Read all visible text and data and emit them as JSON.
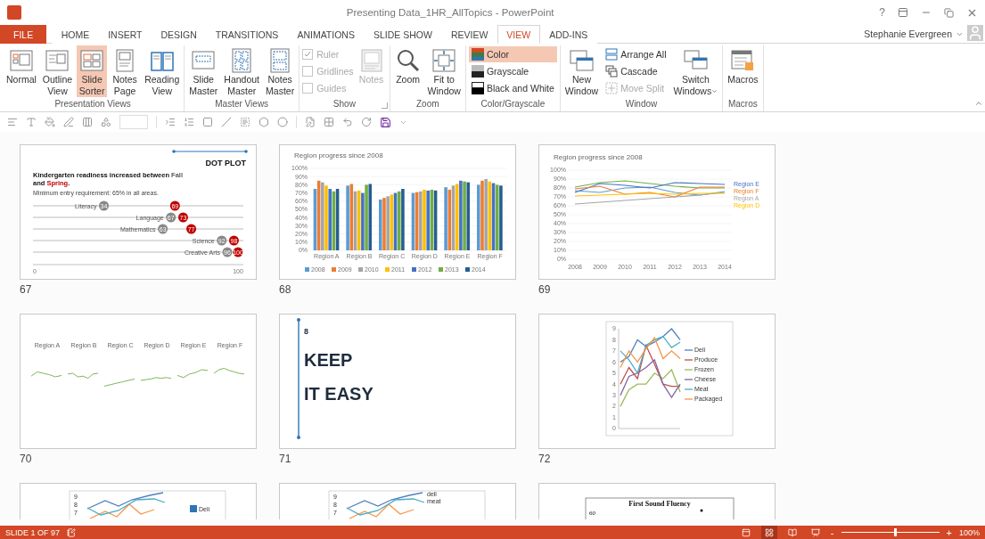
{
  "window": {
    "title": "Presenting Data_1HR_AllTopics - PowerPoint",
    "help": "?"
  },
  "tabs": [
    {
      "label": "FILE",
      "kind": "file",
      "selected": false
    },
    {
      "label": "HOME",
      "kind": "tab",
      "selected": false
    },
    {
      "label": "INSERT",
      "kind": "tab",
      "selected": false
    },
    {
      "label": "DESIGN",
      "kind": "tab",
      "selected": false
    },
    {
      "label": "TRANSITIONS",
      "kind": "tab",
      "selected": false
    },
    {
      "label": "ANIMATIONS",
      "kind": "tab",
      "selected": false
    },
    {
      "label": "SLIDE SHOW",
      "kind": "tab",
      "selected": false
    },
    {
      "label": "REVIEW",
      "kind": "tab",
      "selected": false
    },
    {
      "label": "VIEW",
      "kind": "tab",
      "selected": true
    },
    {
      "label": "ADD-INS",
      "kind": "tab",
      "selected": false
    }
  ],
  "user": {
    "name": "Stephanie Evergreen"
  },
  "ribbon_groups": [
    {
      "label": "Presentation Views",
      "items": [
        {
          "kind": "large",
          "lines": [
            "Normal"
          ],
          "selected": false
        },
        {
          "kind": "large",
          "lines": [
            "Outline",
            "View"
          ],
          "selected": false
        },
        {
          "kind": "large",
          "lines": [
            "Slide",
            "Sorter"
          ],
          "selected": true
        },
        {
          "kind": "large",
          "lines": [
            "Notes",
            "Page"
          ],
          "selected": false
        },
        {
          "kind": "large",
          "lines": [
            "Reading",
            "View"
          ],
          "selected": false
        }
      ]
    },
    {
      "label": "Master Views",
      "items": [
        {
          "kind": "large",
          "lines": [
            "Slide",
            "Master"
          ],
          "selected": false
        },
        {
          "kind": "large",
          "lines": [
            "Handout",
            "Master"
          ],
          "selected": false
        },
        {
          "kind": "large",
          "lines": [
            "Notes",
            "Master"
          ],
          "selected": false
        }
      ]
    },
    {
      "label": "Show",
      "launcher": true,
      "items": [
        {
          "kind": "checks",
          "checks": [
            {
              "label": "Ruler",
              "checked": true,
              "disabled": true
            },
            {
              "label": "Gridlines",
              "checked": false,
              "disabled": true
            },
            {
              "label": "Guides",
              "checked": false,
              "disabled": true
            }
          ]
        },
        {
          "kind": "large",
          "lines": [
            "Notes"
          ],
          "selected": false,
          "disabled": true
        }
      ]
    },
    {
      "label": "Zoom",
      "items": [
        {
          "kind": "large",
          "lines": [
            "Zoom"
          ],
          "selected": false
        },
        {
          "kind": "large",
          "lines": [
            "Fit to",
            "Window"
          ],
          "selected": false
        }
      ]
    },
    {
      "label": "Color/Grayscale",
      "items": [
        {
          "kind": "smalls",
          "smalls": [
            {
              "label": "Color",
              "selected": true,
              "disabled": false
            },
            {
              "label": "Grayscale",
              "selected": false,
              "disabled": false
            },
            {
              "label": "Black and White",
              "selected": false,
              "disabled": false
            }
          ]
        }
      ]
    },
    {
      "label": "Window",
      "items": [
        {
          "kind": "large",
          "lines": [
            "New",
            "Window"
          ],
          "selected": false
        },
        {
          "kind": "smalls",
          "smalls": [
            {
              "label": "Arrange All",
              "selected": false,
              "disabled": false
            },
            {
              "label": "Cascade",
              "selected": false,
              "disabled": false
            },
            {
              "label": "Move Split",
              "selected": false,
              "disabled": true
            }
          ]
        },
        {
          "kind": "large",
          "lines": [
            "Switch",
            "Windows"
          ],
          "selected": false,
          "dropdown": true
        }
      ]
    },
    {
      "label": "Macros",
      "items": [
        {
          "kind": "large",
          "lines": [
            "Macros"
          ],
          "selected": false
        }
      ]
    }
  ],
  "slides": [
    {
      "number": "67",
      "kind": "dot_plot",
      "tag": "DOT PLOT",
      "headline": [
        [
          {
            "text": "Kindergarten readiness increased between "
          },
          {
            "text": "Fall",
            "color": "#595959"
          }
        ],
        [
          {
            "text": "and "
          },
          {
            "text": "Spring",
            "color": "#c00000"
          },
          {
            "text": "."
          }
        ]
      ],
      "subtitle": "Minimum entry requirement: 65% in all areas.",
      "rows": [
        {
          "label": "Literacy",
          "fall": "34",
          "spring": "69"
        },
        {
          "label": "Language",
          "fall": "67",
          "spring": "73"
        },
        {
          "label": "Mathematics",
          "fall": "63",
          "spring": "77"
        },
        {
          "label": "Science",
          "fall": "92",
          "spring": "98"
        },
        {
          "label": "Creative Arts",
          "fall": "96",
          "spring": "100"
        }
      ],
      "axis": [
        "0",
        "100"
      ]
    },
    {
      "number": "68",
      "kind": "chart",
      "chart_data": {
        "type": "bar",
        "title": "Region progress since 2008",
        "grid": true,
        "legend": true,
        "categories": [
          "Region A",
          "Region B",
          "Region C",
          "Region D",
          "Region E",
          "Region F"
        ],
        "series": [
          {
            "name": "2008",
            "color": "#5b9bd5",
            "values": [
              75,
              79,
              62,
              70,
              77,
              80
            ]
          },
          {
            "name": "2009",
            "color": "#ed7d31",
            "values": [
              85,
              81,
              64,
              71,
              74,
              85
            ]
          },
          {
            "name": "2010",
            "color": "#a5a5a5",
            "values": [
              83,
              72,
              66,
              72,
              79,
              87
            ]
          },
          {
            "name": "2011",
            "color": "#ffc000",
            "values": [
              79,
              73,
              68,
              74,
              81,
              84
            ]
          },
          {
            "name": "2012",
            "color": "#4472c4",
            "values": [
              75,
              70,
              70,
              73,
              85,
              82
            ]
          },
          {
            "name": "2013",
            "color": "#70ad47",
            "values": [
              72,
              80,
              72,
              74,
              84,
              80
            ]
          },
          {
            "name": "2014",
            "color": "#255e91",
            "values": [
              75,
              81,
              75,
              73,
              83,
              79
            ]
          }
        ],
        "ylim": [
          0,
          100
        ],
        "yticks": [
          {
            "value": 0,
            "label": "0%"
          },
          {
            "value": 10,
            "label": "10%"
          },
          {
            "value": 20,
            "label": "20%"
          },
          {
            "value": 30,
            "label": "30%"
          },
          {
            "value": 40,
            "label": "40%"
          },
          {
            "value": 50,
            "label": "50%"
          },
          {
            "value": 60,
            "label": "60%"
          },
          {
            "value": 70,
            "label": "70%"
          },
          {
            "value": 80,
            "label": "80%"
          },
          {
            "value": 90,
            "label": "90%"
          },
          {
            "value": 100,
            "label": "100%"
          }
        ]
      }
    },
    {
      "number": "69",
      "kind": "chart",
      "chart_data": {
        "type": "line",
        "title": "Region progress since 2008",
        "grid": true,
        "legend": true,
        "categories": [
          "2008",
          "2009",
          "2010",
          "2011",
          "2012",
          "2013",
          "2014"
        ],
        "series": [
          {
            "color": "#70ad47",
            "values": [
              81,
              86,
              88,
              85,
              82,
              80,
              80
            ]
          },
          {
            "color": "#5b9bd5",
            "values": [
              77,
              75,
              80,
              81,
              75,
              72,
              76
            ]
          },
          {
            "name": "Region E",
            "color": "#4472c4",
            "values": [
              75,
              85,
              83,
              80,
              86,
              85,
              84
            ]
          },
          {
            "name": "Region F",
            "color": "#ed7d31",
            "values": [
              79,
              82,
              73,
              75,
              70,
              81,
              81
            ]
          },
          {
            "name": "Region A",
            "color": "#a5a5a5",
            "values": [
              62,
              64,
              66,
              68,
              70,
              72,
              75
            ]
          },
          {
            "name": "Region D",
            "color": "#ffc000",
            "values": [
              71,
              72,
              73,
              74,
              73,
              74,
              74
            ]
          }
        ],
        "ylim": [
          0,
          100
        ],
        "yticks": [
          {
            "value": 0,
            "label": "0%"
          },
          {
            "value": 10,
            "label": "10%"
          },
          {
            "value": 20,
            "label": "20%"
          },
          {
            "value": 30,
            "label": "30%"
          },
          {
            "value": 40,
            "label": "40%"
          },
          {
            "value": 50,
            "label": "50%"
          },
          {
            "value": 60,
            "label": "60%"
          },
          {
            "value": 70,
            "label": "70%"
          },
          {
            "value": 80,
            "label": "80%"
          },
          {
            "value": 90,
            "label": "90%"
          },
          {
            "value": 100,
            "label": "100%"
          }
        ]
      }
    },
    {
      "number": "70",
      "kind": "small_multiples",
      "panels": [
        "Region A",
        "Region B",
        "Region C",
        "Region D",
        "Region E",
        "Region F"
      ]
    },
    {
      "number": "71",
      "kind": "title",
      "index": "8",
      "lines": [
        "KEEP",
        "IT EASY"
      ]
    },
    {
      "number": "72",
      "kind": "chart",
      "chart_data": {
        "type": "line",
        "legend": true,
        "series": [
          {
            "name": "Deli",
            "color": "#4f81bd",
            "values": [
              6,
              6.5,
              8,
              7.4,
              7.8,
              8.3,
              9,
              8
            ]
          },
          {
            "name": "Produce",
            "color": "#c0504d",
            "values": [
              4,
              5.5,
              4.5,
              7.5,
              5.8,
              4,
              3.8,
              3.8
            ]
          },
          {
            "name": "Frozen",
            "color": "#9bbb59",
            "values": [
              2,
              3.5,
              4,
              4,
              5,
              4.5,
              5.3,
              3.3
            ]
          },
          {
            "name": "Cheese",
            "color": "#8064a2",
            "values": [
              3,
              4.7,
              5,
              5.5,
              6.2,
              4,
              2.8,
              4
            ]
          },
          {
            "name": "Meat",
            "color": "#4bacc6",
            "values": [
              7,
              6.2,
              5,
              7.5,
              8,
              8.3,
              7.3,
              7.8
            ]
          },
          {
            "name": "Packaged",
            "color": "#f79646",
            "values": [
              5.5,
              7,
              6,
              7.2,
              8.2,
              6.3,
              7,
              6.3
            ]
          }
        ],
        "ylim": [
          0,
          9
        ],
        "yticks": [
          0,
          1,
          2,
          3,
          4,
          5,
          6,
          7,
          8,
          9
        ]
      }
    },
    {
      "kind": "cut_line",
      "ticks": [
        "9",
        "8",
        "7"
      ],
      "legend": [
        "Deli"
      ]
    },
    {
      "kind": "cut_labels",
      "ticks": [
        "9",
        "8",
        "7"
      ],
      "labels": [
        "deli",
        "meat"
      ]
    },
    {
      "kind": "cut_table",
      "title": "First Sound Fluency",
      "tick": "60"
    }
  ],
  "status_bar": {
    "slide": "SLIDE 1 OF 97",
    "views": [
      {
        "selected": false
      },
      {
        "selected": true
      },
      {
        "selected": false
      },
      {
        "selected": false
      }
    ],
    "zoom_minus": "-",
    "zoom_plus": "+",
    "zoom": {
      "level": 0.55
    },
    "zoom_text": "100%"
  }
}
